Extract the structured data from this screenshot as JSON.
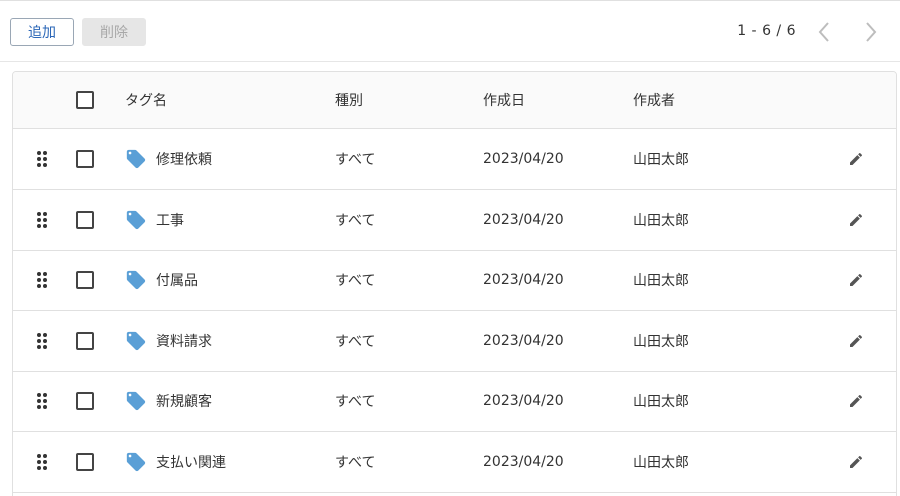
{
  "toolbar": {
    "add_label": "追加",
    "delete_label": "削除",
    "pagination": "1 - 6 / 6"
  },
  "table": {
    "columns": {
      "name": "タグ名",
      "type": "種別",
      "created": "作成日",
      "author": "作成者"
    },
    "rows": [
      {
        "name": "修理依頼",
        "type": "すべて",
        "created": "2023/04/20",
        "author": "山田太郎"
      },
      {
        "name": "工事",
        "type": "すべて",
        "created": "2023/04/20",
        "author": "山田太郎"
      },
      {
        "name": "付属品",
        "type": "すべて",
        "created": "2023/04/20",
        "author": "山田太郎"
      },
      {
        "name": "資料請求",
        "type": "すべて",
        "created": "2023/04/20",
        "author": "山田太郎"
      },
      {
        "name": "新規顧客",
        "type": "すべて",
        "created": "2023/04/20",
        "author": "山田太郎"
      },
      {
        "name": "支払い関連",
        "type": "すべて",
        "created": "2023/04/20",
        "author": "山田太郎"
      }
    ]
  },
  "colors": {
    "tag_icon": "#5a9fd6",
    "add_button_text": "#2a66b7",
    "disabled_button_bg": "#e6e6e6",
    "border": "#e0e0e0"
  },
  "icons": {
    "drag": "drag-handle-icon",
    "tag": "tag-icon",
    "edit": "pencil-icon",
    "prev": "chevron-left-icon",
    "next": "chevron-right-icon"
  }
}
